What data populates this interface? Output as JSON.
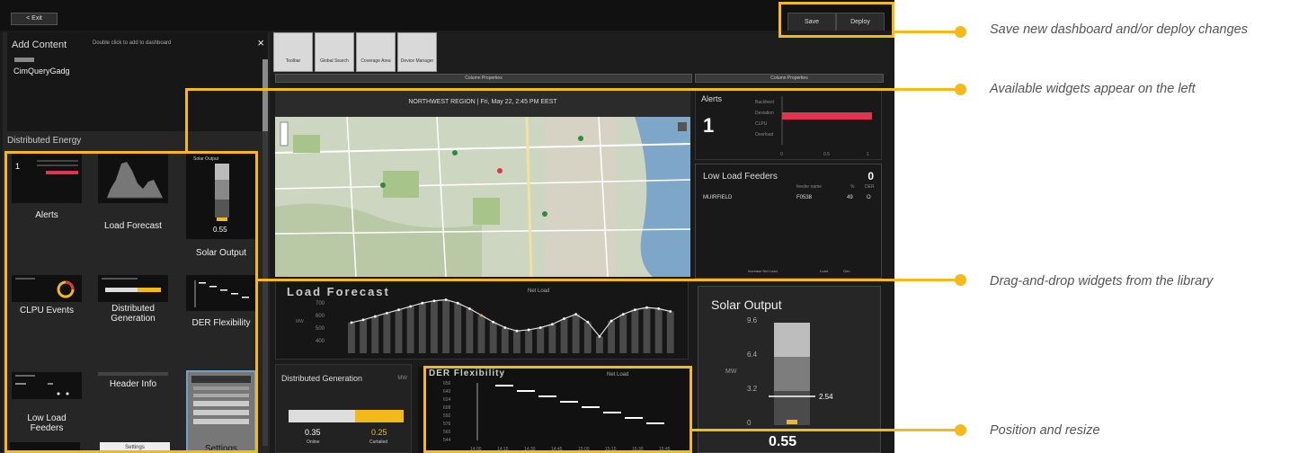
{
  "toolbar": {
    "exit_label": "< Exit",
    "save_label": "Save",
    "deploy_label": "Deploy"
  },
  "add_content": {
    "title": "Add Content",
    "hint": "Double click to add to dashboard",
    "close": "×",
    "item": "CimQueryGadg"
  },
  "library": {
    "section_title": "Distributed Energy",
    "widgets": [
      {
        "label": "Alerts",
        "thumb_value": "1"
      },
      {
        "label": "Load Forecast"
      },
      {
        "label": "Solar Output",
        "thumb_title": "Solar Output",
        "thumb_value": "0.55"
      },
      {
        "label": "CLPU Events"
      },
      {
        "label": "Distributed Generation"
      },
      {
        "label": "DER Flexibility"
      },
      {
        "label": "Low Load Feeders"
      },
      {
        "label": "Header Info"
      },
      {
        "label": "Settings"
      }
    ],
    "bottom_thumb": "Settings"
  },
  "tabs": {
    "tiles": [
      "Toolbar",
      "Global Search",
      "Coverage Area",
      "Device Manager"
    ],
    "column_properties": "Column Properties"
  },
  "header": {
    "text": "NORTHWEST REGION   |   Fri, May 22, 2:45 PM EEST"
  },
  "load_forecast": {
    "title": "Load Forecast",
    "legend": "Net Load",
    "y_ticks": [
      "700",
      "600",
      "500",
      "400"
    ],
    "mw": "MW"
  },
  "distributed_generation": {
    "title": "Distributed Generation",
    "unit": "MW",
    "online_value": "0.35",
    "curtailed_value": "0.25",
    "online_label": "Online",
    "curtailed_label": "Curtailed",
    "curtailed_fraction": 0.42
  },
  "der_flexibility": {
    "title": "DER Flexibility",
    "legend": "Net Load",
    "y_ticks": [
      "656",
      "640",
      "624",
      "608",
      "592",
      "576",
      "560",
      "544"
    ],
    "x_ticks": [
      "14:00",
      "14:15",
      "14:30",
      "14:45",
      "15:00",
      "15:15",
      "15:30",
      "15:45"
    ]
  },
  "alerts": {
    "title": "Alerts",
    "count": "1",
    "categories": [
      "Backfeed",
      "Deviation",
      "CLPU",
      "Overload"
    ],
    "x_ticks": [
      "0",
      "0.5",
      "1"
    ]
  },
  "low_load_feeders": {
    "title": "Low Load Feeders",
    "count": "0",
    "col_feeder": "feeder name",
    "col_pct": "%",
    "col_der": "DER",
    "row_substation": "MUIRFIELD",
    "row_feeder": "F0538",
    "row_pct": "49",
    "row_der": "O",
    "legend_a": "Increase Net Load",
    "legend_b": "Load",
    "legend_c": "Gen"
  },
  "solar_output": {
    "title": "Solar Output",
    "y_ticks": [
      "9.6",
      "6.4",
      "3.2",
      "0"
    ],
    "mw": "MW",
    "marker": "2.54",
    "value": "0.55"
  },
  "callouts": {
    "save": "Save new dashboard and/or deploy changes",
    "widgets": "Available widgets appear on the left",
    "drag": "Drag-and-drop widgets from the library",
    "position": "Position and resize"
  },
  "colors": {
    "accent": "#f5b91b",
    "alert_red": "#e0344f",
    "panel": "#1b1b1b"
  }
}
